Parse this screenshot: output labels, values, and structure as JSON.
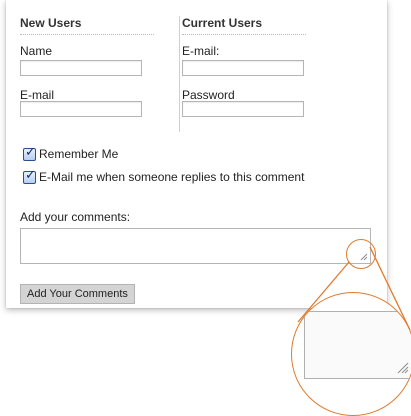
{
  "new_users": {
    "heading": "New Users",
    "name_label": "Name",
    "email_label": "E-mail"
  },
  "current_users": {
    "heading": "Current Users",
    "email_label": "E-mail:",
    "password_label": "Password"
  },
  "options": {
    "remember_label": "Remember Me",
    "notify_label": "E-Mail me when someone replies to this comment"
  },
  "comments": {
    "label": "Add your comments:",
    "button_label": "Add Your Comments"
  },
  "colors": {
    "accent": "#e07a2c",
    "checkbox": "#2a4f8a",
    "button_bg": "#d4d4d4"
  },
  "icons": {
    "checkbox_checked": "checkmark-icon",
    "resize_handle": "resize-grip-icon"
  }
}
